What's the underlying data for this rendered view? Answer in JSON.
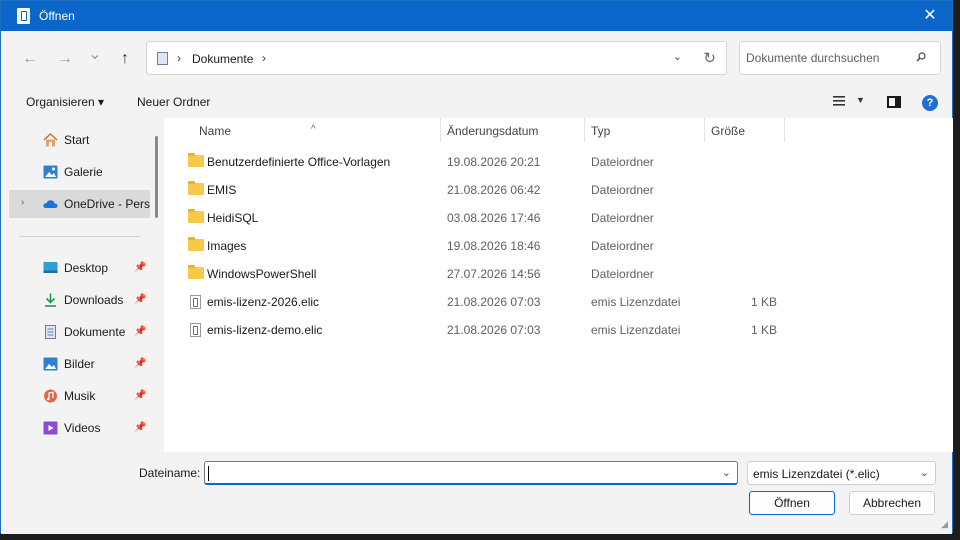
{
  "window": {
    "title": "Öffnen",
    "close_glyph": "✕"
  },
  "nav": {
    "back_glyph": "←",
    "forward_glyph": "→",
    "recent_glyph": "⌄",
    "up_glyph": "↑",
    "breadcrumb": [
      "Dokumente"
    ],
    "sep_glyph": "›",
    "address_dropdown_glyph": "⌄",
    "refresh_glyph": "↻"
  },
  "search": {
    "placeholder": "Dokumente durchsuchen"
  },
  "toolbar": {
    "organize_label": "Organisieren ▾",
    "new_folder_label": "Neuer Ordner",
    "view_dropdown_glyph": "▼",
    "help_glyph": "?"
  },
  "sidebar": {
    "items": [
      {
        "label": "Start",
        "icon": "home-icon"
      },
      {
        "label": "Galerie",
        "icon": "gallery-icon"
      },
      {
        "label": "OneDrive - Persönlich",
        "icon": "cloud-icon",
        "selected": true,
        "chevron": "›"
      },
      {
        "label": "Desktop",
        "icon": "desktop-icon",
        "pinned": true
      },
      {
        "label": "Downloads",
        "icon": "download-icon",
        "pinned": true
      },
      {
        "label": "Dokumente",
        "icon": "document-icon",
        "pinned": true
      },
      {
        "label": "Bilder",
        "icon": "pictures-icon",
        "pinned": true
      },
      {
        "label": "Musik",
        "icon": "music-icon",
        "pinned": true
      },
      {
        "label": "Videos",
        "icon": "video-icon",
        "pinned": true
      }
    ],
    "pin_glyph": "📌"
  },
  "columns": {
    "name": "Name",
    "date": "Änderungsdatum",
    "type": "Typ",
    "size": "Größe",
    "sort_glyph": "^"
  },
  "files": [
    {
      "name": "Benutzerdefinierte Office-Vorlagen",
      "date": "19.08.2026 20:21",
      "type": "Dateiordner",
      "size": "",
      "kind": "folder"
    },
    {
      "name": "EMIS",
      "date": "21.08.2026 06:42",
      "type": "Dateiordner",
      "size": "",
      "kind": "folder"
    },
    {
      "name": "HeidiSQL",
      "date": "03.08.2026 17:46",
      "type": "Dateiordner",
      "size": "",
      "kind": "folder"
    },
    {
      "name": "Images",
      "date": "19.08.2026 18:46",
      "type": "Dateiordner",
      "size": "",
      "kind": "folder"
    },
    {
      "name": "WindowsPowerShell",
      "date": "27.07.2026 14:56",
      "type": "Dateiordner",
      "size": "",
      "kind": "folder"
    },
    {
      "name": "emis-lizenz-2026.elic",
      "date": "21.08.2026 07:03",
      "type": "emis Lizenzdatei",
      "size": "1 KB",
      "kind": "file"
    },
    {
      "name": "emis-lizenz-demo.elic",
      "date": "21.08.2026 07:03",
      "type": "emis Lizenzdatei",
      "size": "1 KB",
      "kind": "file"
    }
  ],
  "bottom": {
    "filename_label": "Dateiname:",
    "filename_value": "",
    "filename_dropdown_glyph": "⌄",
    "filter_value": "emis Lizenzdatei (*.elic)",
    "filter_dropdown_glyph": "⌄",
    "open_label": "Öffnen",
    "cancel_label": "Abbrechen"
  },
  "colors": {
    "title_bar": "#0a66c8",
    "accent": "#0a66c8",
    "folder": "#f7c948"
  }
}
